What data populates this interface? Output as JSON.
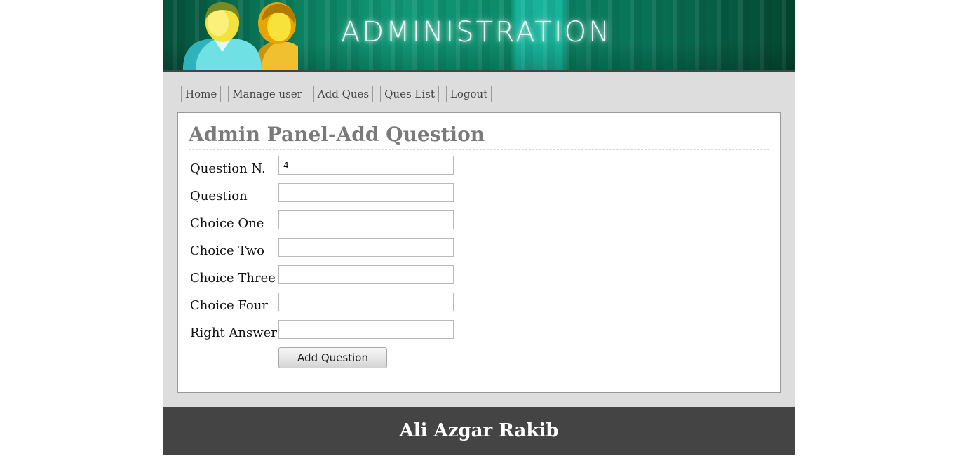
{
  "header": {
    "title": "ADMINISTRATION",
    "logo_icon": "users-icon"
  },
  "nav": {
    "items": [
      {
        "label": "Home"
      },
      {
        "label": "Manage user"
      },
      {
        "label": "Add Ques"
      },
      {
        "label": "Ques List"
      },
      {
        "label": "Logout"
      }
    ]
  },
  "panel": {
    "title": "Admin Panel-Add Question",
    "fields": [
      {
        "label": "Question N.",
        "value": "4"
      },
      {
        "label": "Question",
        "value": ""
      },
      {
        "label": "Choice One",
        "value": ""
      },
      {
        "label": "Choice Two",
        "value": ""
      },
      {
        "label": "Choice Three",
        "value": ""
      },
      {
        "label": "Choice Four",
        "value": ""
      },
      {
        "label": "Right Answer",
        "value": ""
      }
    ],
    "submit_label": "Add Question"
  },
  "footer": {
    "text": "Ali Azgar Rakib"
  },
  "colors": {
    "header_green": "#0a7a5a",
    "content_bg": "#dddddd",
    "footer_bg": "#444444",
    "title_gray": "#7a7a7a"
  }
}
